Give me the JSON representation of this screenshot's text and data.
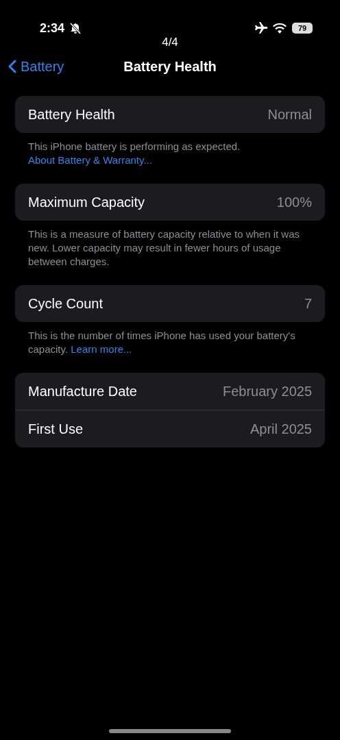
{
  "status_bar": {
    "time": "2:34",
    "silent": true,
    "airplane_mode": true,
    "battery_percent": "79"
  },
  "page_indicator": "4/4",
  "nav": {
    "back_label": "Battery",
    "title": "Battery Health"
  },
  "sections": [
    {
      "rows": [
        {
          "label": "Battery Health",
          "value": "Normal"
        }
      ],
      "footer": "This iPhone battery is performing as expected.",
      "footer_link": "About Battery & Warranty..."
    },
    {
      "rows": [
        {
          "label": "Maximum Capacity",
          "value": "100%"
        }
      ],
      "footer": "This is a measure of battery capacity relative to when it was new. Lower capacity may result in fewer hours of usage between charges."
    },
    {
      "rows": [
        {
          "label": "Cycle Count",
          "value": "7"
        }
      ],
      "footer": "This is the number of times iPhone has used your battery's capacity.",
      "footer_link": "Learn more..."
    },
    {
      "rows": [
        {
          "label": "Manufacture Date",
          "value": "February 2025"
        },
        {
          "label": "First Use",
          "value": "April 2025"
        }
      ]
    }
  ]
}
